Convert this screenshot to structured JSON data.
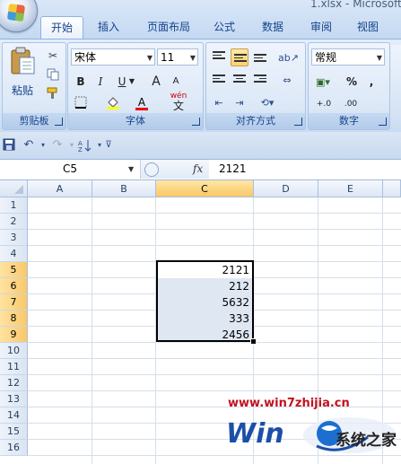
{
  "window": {
    "file_title": "1.xlsx - Microsoft"
  },
  "tabs": [
    {
      "label": "开始",
      "active": true
    },
    {
      "label": "插入"
    },
    {
      "label": "页面布局"
    },
    {
      "label": "公式"
    },
    {
      "label": "数据"
    },
    {
      "label": "审阅"
    },
    {
      "label": "视图"
    }
  ],
  "ribbon": {
    "clipboard": {
      "paste_label": "粘贴",
      "group_label": "剪贴板"
    },
    "font": {
      "font_name": "宋体",
      "font_size": "11",
      "bold": "B",
      "italic": "I",
      "underline": "U",
      "grow": "A",
      "shrink": "A",
      "color_a": "A",
      "wen": "wén",
      "wen_char": "文",
      "group_label": "字体"
    },
    "alignment": {
      "group_label": "对齐方式"
    },
    "number": {
      "format": "常规",
      "percent": "%",
      "comma": ",",
      "dec_inc": "+.0",
      "dec_dec": ".00",
      "group_label": "数字"
    }
  },
  "formula_bar": {
    "name_box": "C5",
    "fx": "fx",
    "value": "2121"
  },
  "grid": {
    "columns": [
      "A",
      "B",
      "C",
      "D",
      "E"
    ],
    "rows": [
      "1",
      "2",
      "3",
      "4",
      "5",
      "6",
      "7",
      "8",
      "9",
      "10",
      "11",
      "12",
      "13",
      "14",
      "15",
      "16"
    ],
    "selected_column": "C",
    "selected_rows": [
      "5",
      "6",
      "7",
      "8",
      "9"
    ],
    "cells": [
      {
        "ref": "C5",
        "value": "2121"
      },
      {
        "ref": "C6",
        "value": "212"
      },
      {
        "ref": "C7",
        "value": "5632"
      },
      {
        "ref": "C8",
        "value": "333"
      },
      {
        "ref": "C9",
        "value": "2456"
      }
    ]
  },
  "watermark": {
    "url": "www.win7zhijia.cn",
    "brand": "系统之家"
  },
  "colors": {
    "ribbon_bg": "#dbe7f6",
    "accent": "#15428b",
    "selection_header": "#f8c766",
    "watermark_red": "#c1121f"
  }
}
